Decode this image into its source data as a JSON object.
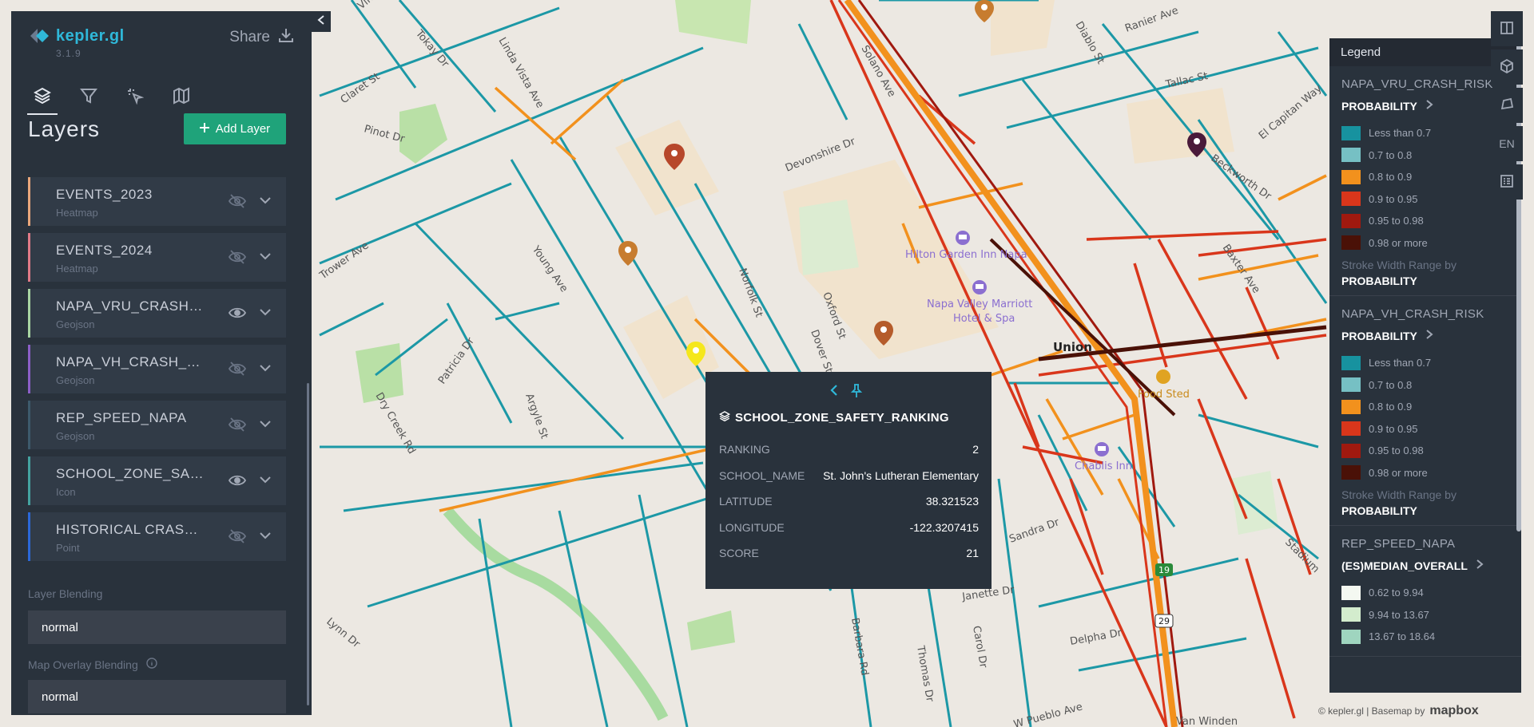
{
  "app": {
    "brand_name": "kepler.gl",
    "version": "3.1.9",
    "share_label": "Share"
  },
  "tabs": [
    {
      "name": "layers",
      "icon": "layers-icon"
    },
    {
      "name": "filters",
      "icon": "filter-icon"
    },
    {
      "name": "interactions",
      "icon": "cursor-sparkle-icon"
    },
    {
      "name": "basemap",
      "icon": "map-icon"
    }
  ],
  "panel": {
    "title": "Layers",
    "add_layer_label": "Add Layer",
    "layer_blending_label": "Layer Blending",
    "layer_blending_value": "normal",
    "map_overlay_label": "Map Overlay Blending",
    "map_overlay_value": "normal"
  },
  "layers": [
    {
      "name": "EVENTS_2023",
      "type": "Heatmap",
      "color": "#e9a77b",
      "visible": false
    },
    {
      "name": "EVENTS_2024",
      "type": "Heatmap",
      "color": "#e07a87",
      "visible": false
    },
    {
      "name": "NAPA_VRU_CRASH_RI...",
      "type": "Geojson",
      "color": "#a8d5a2",
      "visible": true
    },
    {
      "name": "NAPA_VH_CRASH_RISK",
      "type": "Geojson",
      "color": "#8c5fc7",
      "visible": false
    },
    {
      "name": "REP_SPEED_NAPA",
      "type": "Geojson",
      "color": "#3d5a6c",
      "visible": false
    },
    {
      "name": "SCHOOL_ZONE_SAFET...",
      "type": "Icon",
      "color": "#44a3a0",
      "visible": true
    },
    {
      "name": "HISTORICAL CRASHES",
      "type": "Point",
      "color": "#2b68d8",
      "visible": false
    }
  ],
  "tooltip": {
    "layer_name": "SCHOOL_ZONE_SAFETY_RANKING",
    "rows": [
      {
        "key": "RANKING",
        "value": "2"
      },
      {
        "key": "SCHOOL_NAME",
        "value": "St. John's Lutheran Elementary"
      },
      {
        "key": "LATITUDE",
        "value": "38.321523"
      },
      {
        "key": "LONGITUDE",
        "value": "-122.3207415"
      },
      {
        "key": "SCORE",
        "value": "21"
      }
    ]
  },
  "legend": {
    "title": "Legend",
    "stroke_label": "Stroke Width Range by",
    "blocks": [
      {
        "layer": "NAPA_VRU_CRASH_RISK",
        "field": "PROBABILITY",
        "stroke_field": "PROBABILITY",
        "entries": [
          {
            "label": "Less than 0.7",
            "color": "#17929f"
          },
          {
            "label": "0.7 to 0.8",
            "color": "#76c0c4"
          },
          {
            "label": "0.8 to 0.9",
            "color": "#f2911d"
          },
          {
            "label": "0.9 to 0.95",
            "color": "#d9361b"
          },
          {
            "label": "0.95 to 0.98",
            "color": "#a0190f"
          },
          {
            "label": "0.98 or more",
            "color": "#4a1107"
          }
        ]
      },
      {
        "layer": "NAPA_VH_CRASH_RISK",
        "field": "PROBABILITY",
        "stroke_field": "PROBABILITY",
        "entries": [
          {
            "label": "Less than 0.7",
            "color": "#17929f"
          },
          {
            "label": "0.7 to 0.8",
            "color": "#76c0c4"
          },
          {
            "label": "0.8 to 0.9",
            "color": "#f2911d"
          },
          {
            "label": "0.9 to 0.95",
            "color": "#d9361b"
          },
          {
            "label": "0.95 to 0.98",
            "color": "#a0190f"
          },
          {
            "label": "0.98 or more",
            "color": "#4a1107"
          }
        ]
      },
      {
        "layer": "REP_SPEED_NAPA",
        "field": "(ES)MEDIAN_OVERALL",
        "entries": [
          {
            "label": "0.62 to 9.94",
            "color": "#f4f8f1"
          },
          {
            "label": "9.94 to 13.67",
            "color": "#d3eccd"
          },
          {
            "label": "13.67 to 18.64",
            "color": "#9fd5bf"
          }
        ]
      }
    ]
  },
  "map_controls": [
    {
      "name": "split-map",
      "icon": "split-view-icon"
    },
    {
      "name": "3d-view",
      "icon": "cube-icon"
    },
    {
      "name": "draw",
      "icon": "polygon-draw-icon"
    },
    {
      "name": "locale",
      "label": "EN"
    },
    {
      "name": "legend-toggle",
      "icon": "legend-icon"
    }
  ],
  "map": {
    "street_labels": [
      "Vine",
      "Tokay Dr",
      "Linda Vista Ave",
      "Claret St",
      "Pinot Dr",
      "Solano Ave",
      "Devonshire Dr",
      "Ranier Ave",
      "Diablo St",
      "Tallac St",
      "El Capitan Way",
      "Beckworth Dr",
      "Baxter Ave",
      "Trower Ave",
      "Young Ave",
      "Norfolk St",
      "Oxford St",
      "Dover St",
      "Patricia Dr",
      "Argyle St",
      "Dry Creek Rd",
      "Lynn Dr",
      "Sandra Dr",
      "Janette Dr",
      "Delpha Dr",
      "Barbara Rd",
      "Thomas Dr",
      "Carol Dr",
      "W Pueblo Ave",
      "Van Winden",
      "Stadium"
    ],
    "poi_labels": [
      "Hilton Garden Inn Napa",
      "Napa Valley Marriott",
      "Hotel & Spa",
      "Chablis Inn",
      "Food Sted"
    ],
    "place_label": "Union",
    "highway_shields": [
      "19",
      "29"
    ]
  },
  "attribution": {
    "text": "© kepler.gl | Basemap by",
    "mapbox": "mapbox"
  }
}
